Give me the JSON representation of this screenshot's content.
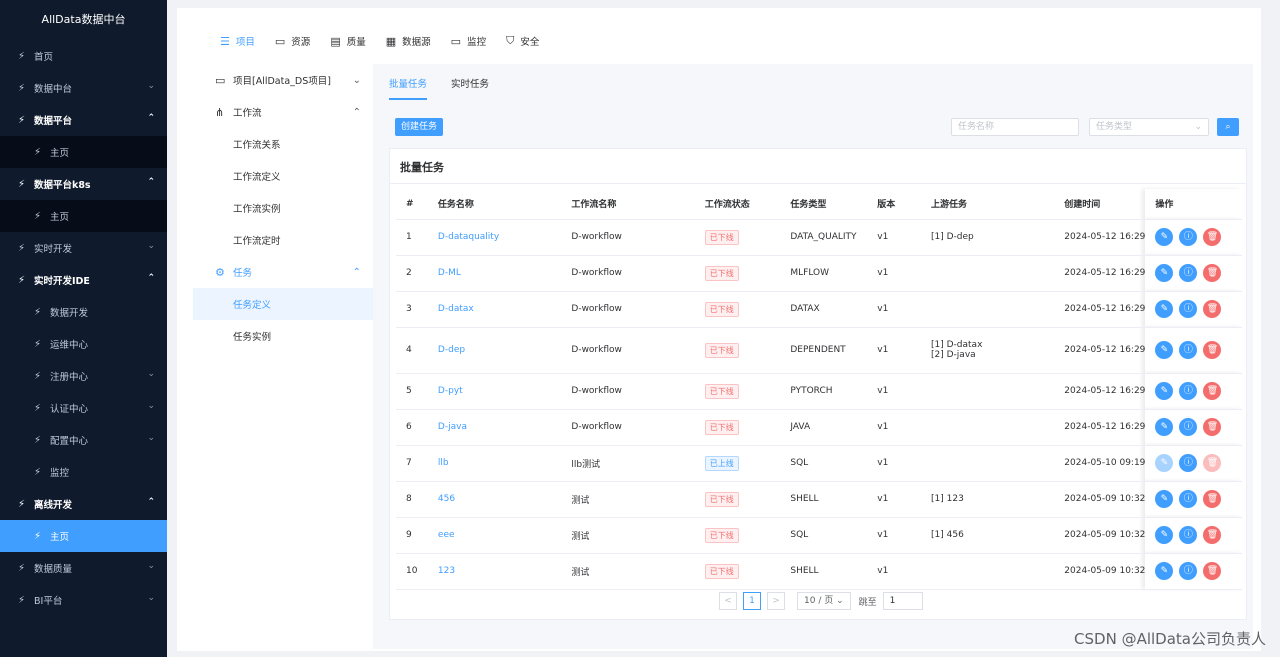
{
  "brand": "AllData数据中台",
  "sidebar": [
    {
      "label": "首页",
      "arrow": "",
      "kind": "top"
    },
    {
      "label": "数据中台",
      "arrow": "⌄",
      "kind": "top"
    },
    {
      "label": "数据平台",
      "arrow": "⌃",
      "kind": "open"
    },
    {
      "label": "主页",
      "arrow": "",
      "kind": "sub"
    },
    {
      "label": "数据平台k8s",
      "arrow": "⌃",
      "kind": "open"
    },
    {
      "label": "主页",
      "arrow": "",
      "kind": "sub"
    },
    {
      "label": "实时开发",
      "arrow": "⌄",
      "kind": "top"
    },
    {
      "label": "实时开发IDE",
      "arrow": "⌃",
      "kind": "open"
    },
    {
      "label": "数据开发",
      "arrow": "",
      "kind": "sub2"
    },
    {
      "label": "运维中心",
      "arrow": "",
      "kind": "sub2"
    },
    {
      "label": "注册中心",
      "arrow": "⌄",
      "kind": "sub2"
    },
    {
      "label": "认证中心",
      "arrow": "⌄",
      "kind": "sub2"
    },
    {
      "label": "配置中心",
      "arrow": "⌄",
      "kind": "sub2"
    },
    {
      "label": "监控",
      "arrow": "",
      "kind": "sub2"
    },
    {
      "label": "离线开发",
      "arrow": "⌃",
      "kind": "open"
    },
    {
      "label": "主页",
      "arrow": "",
      "kind": "active"
    },
    {
      "label": "数据质量",
      "arrow": "⌄",
      "kind": "top"
    },
    {
      "label": "BI平台",
      "arrow": "⌄",
      "kind": "top"
    }
  ],
  "topnav": [
    {
      "label": "项目",
      "icon": "list-icon",
      "active": true
    },
    {
      "label": "资源",
      "icon": "folder-icon",
      "active": false
    },
    {
      "label": "质量",
      "icon": "document-icon",
      "active": false
    },
    {
      "label": "数据源",
      "icon": "database-icon",
      "active": false
    },
    {
      "label": "监控",
      "icon": "monitor-icon",
      "active": false
    },
    {
      "label": "安全",
      "icon": "shield-icon",
      "active": false
    }
  ],
  "subside": {
    "project": "项目[AllData_DS项目]",
    "workflow": "工作流",
    "workflow_items": [
      "工作流关系",
      "工作流定义",
      "工作流实例",
      "工作流定时"
    ],
    "task": "任务",
    "task_items": [
      "任务定义",
      "任务实例"
    ]
  },
  "tabs": [
    "批量任务",
    "实时任务"
  ],
  "toolbar": {
    "create": "创建任务",
    "search_placeholder": "任务名称",
    "type_placeholder": "任务类型"
  },
  "card_title": "批量任务",
  "columns": [
    "#",
    "任务名称",
    "工作流名称",
    "工作流状态",
    "任务类型",
    "版本",
    "上游任务",
    "创建时间",
    "操作"
  ],
  "rows": [
    {
      "no": "1",
      "name": "D-dataquality",
      "workflow": "D-workflow",
      "status": "已下线",
      "type": "DATA_QUALITY",
      "version": "v1",
      "upstream": [
        "[1] D-dep"
      ],
      "created": "2024-05-12 16:29"
    },
    {
      "no": "2",
      "name": "D-ML",
      "workflow": "D-workflow",
      "status": "已下线",
      "type": "MLFLOW",
      "version": "v1",
      "upstream": [],
      "created": "2024-05-12 16:29"
    },
    {
      "no": "3",
      "name": "D-datax",
      "workflow": "D-workflow",
      "status": "已下线",
      "type": "DATAX",
      "version": "v1",
      "upstream": [],
      "created": "2024-05-12 16:29"
    },
    {
      "no": "4",
      "name": "D-dep",
      "workflow": "D-workflow",
      "status": "已下线",
      "type": "DEPENDENT",
      "version": "v1",
      "upstream": [
        "[1] D-datax",
        "[2] D-java"
      ],
      "created": "2024-05-12 16:29"
    },
    {
      "no": "5",
      "name": "D-pyt",
      "workflow": "D-workflow",
      "status": "已下线",
      "type": "PYTORCH",
      "version": "v1",
      "upstream": [],
      "created": "2024-05-12 16:29"
    },
    {
      "no": "6",
      "name": "D-java",
      "workflow": "D-workflow",
      "status": "已下线",
      "type": "JAVA",
      "version": "v1",
      "upstream": [],
      "created": "2024-05-12 16:29"
    },
    {
      "no": "7",
      "name": "llb",
      "workflow": "llb测试",
      "status": "已上线",
      "type": "SQL",
      "version": "v1",
      "upstream": [],
      "created": "2024-05-10 09:19"
    },
    {
      "no": "8",
      "name": "456",
      "workflow": "测试",
      "status": "已下线",
      "type": "SHELL",
      "version": "v1",
      "upstream": [
        "[1] 123"
      ],
      "created": "2024-05-09 10:32"
    },
    {
      "no": "9",
      "name": "eee",
      "workflow": "测试",
      "status": "已下线",
      "type": "SQL",
      "version": "v1",
      "upstream": [
        "[1] 456"
      ],
      "created": "2024-05-09 10:32"
    },
    {
      "no": "10",
      "name": "123",
      "workflow": "测试",
      "status": "已下线",
      "type": "SHELL",
      "version": "v1",
      "upstream": [],
      "created": "2024-05-09 10:32"
    }
  ],
  "pager": {
    "prev": "<",
    "page": "1",
    "next": ">",
    "size": "10 / 页",
    "jump_label": "跳至",
    "jump_value": "1"
  },
  "watermark": "CSDN @AllData公司负责人"
}
